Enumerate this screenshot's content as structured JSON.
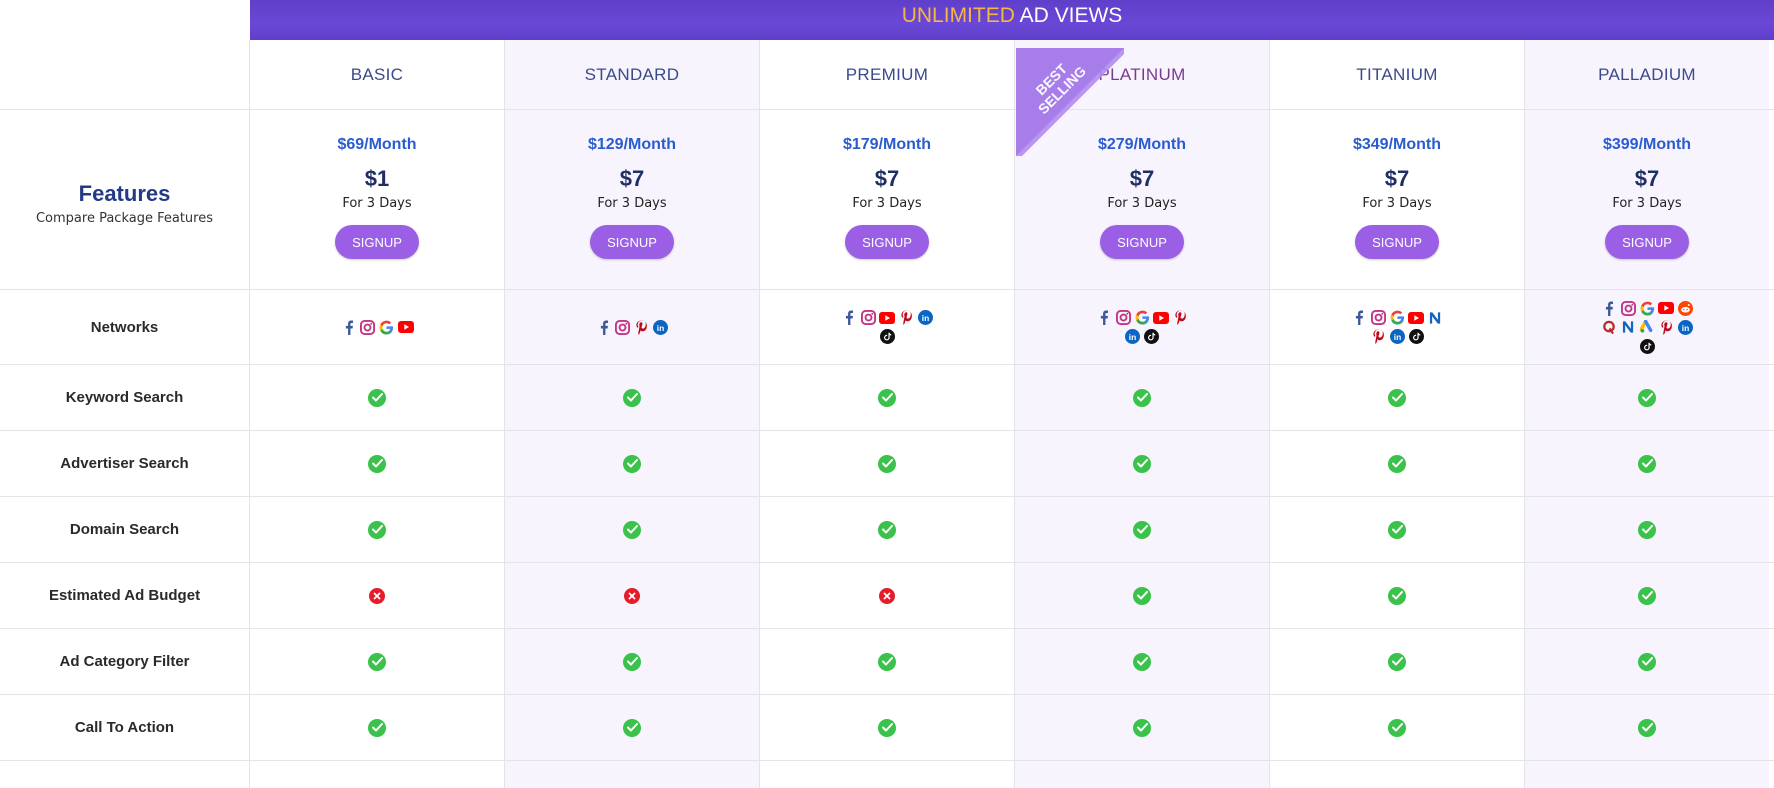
{
  "banner": {
    "highlight": "UNLIMITED",
    "rest": "AD VIEWS"
  },
  "features_header": {
    "title": "Features",
    "subtitle": "Compare Package Features"
  },
  "ribbon": {
    "line1": "BEST",
    "line2": "SELLING"
  },
  "colors": {
    "accent": "#6a48d6",
    "highlight": "#f7b640",
    "button": "#9b5fe6",
    "yes": "#3ac24a",
    "no": "#e51d2a"
  },
  "plans": [
    {
      "name": "BASIC",
      "monthly": "$69/Month",
      "trial_price": "$1",
      "trial_days": "For 3 Days",
      "signup": "SIGNUP",
      "networks": [
        "facebook-icon",
        "instagram-icon",
        "google-icon",
        "youtube-icon"
      ],
      "features": [
        true,
        true,
        true,
        false,
        true,
        true
      ]
    },
    {
      "name": "STANDARD",
      "monthly": "$129/Month",
      "trial_price": "$7",
      "trial_days": "For 3 Days",
      "signup": "SIGNUP",
      "networks": [
        "facebook-icon",
        "instagram-icon",
        "pinterest-icon",
        "linkedin-icon"
      ],
      "features": [
        true,
        true,
        true,
        false,
        true,
        true
      ]
    },
    {
      "name": "PREMIUM",
      "monthly": "$179/Month",
      "trial_price": "$7",
      "trial_days": "For 3 Days",
      "signup": "SIGNUP",
      "networks": [
        "facebook-icon",
        "instagram-icon",
        "youtube-icon",
        "pinterest-icon",
        "linkedin-icon",
        "tiktok-icon"
      ],
      "features": [
        true,
        true,
        true,
        false,
        true,
        true
      ]
    },
    {
      "name": "PLATINUM",
      "monthly": "$279/Month",
      "trial_price": "$7",
      "trial_days": "For 3 Days",
      "signup": "SIGNUP",
      "networks": [
        "facebook-icon",
        "instagram-icon",
        "google-icon",
        "youtube-icon",
        "pinterest-icon",
        "linkedin-icon",
        "tiktok-icon"
      ],
      "features": [
        true,
        true,
        true,
        true,
        true,
        true
      ]
    },
    {
      "name": "TITANIUM",
      "monthly": "$349/Month",
      "trial_price": "$7",
      "trial_days": "For 3 Days",
      "signup": "SIGNUP",
      "networks": [
        "facebook-icon",
        "instagram-icon",
        "google-icon",
        "youtube-icon",
        "native-icon",
        "pinterest-icon",
        "linkedin-icon",
        "tiktok-icon"
      ],
      "features": [
        true,
        true,
        true,
        true,
        true,
        true
      ]
    },
    {
      "name": "PALLADIUM",
      "monthly": "$399/Month",
      "trial_price": "$7",
      "trial_days": "For 3 Days",
      "signup": "SIGNUP",
      "networks": [
        "facebook-icon",
        "instagram-icon",
        "google-icon",
        "youtube-icon",
        "reddit-icon",
        "quora-icon",
        "native-icon",
        "google-ads-icon",
        "pinterest-icon",
        "linkedin-icon",
        "tiktok-icon"
      ],
      "features": [
        true,
        true,
        true,
        true,
        true,
        true
      ]
    }
  ],
  "rows": {
    "networks": "Networks",
    "features": [
      "Keyword Search",
      "Advertiser Search",
      "Domain Search",
      "Estimated Ad Budget",
      "Ad Category Filter",
      "Call To Action"
    ]
  }
}
